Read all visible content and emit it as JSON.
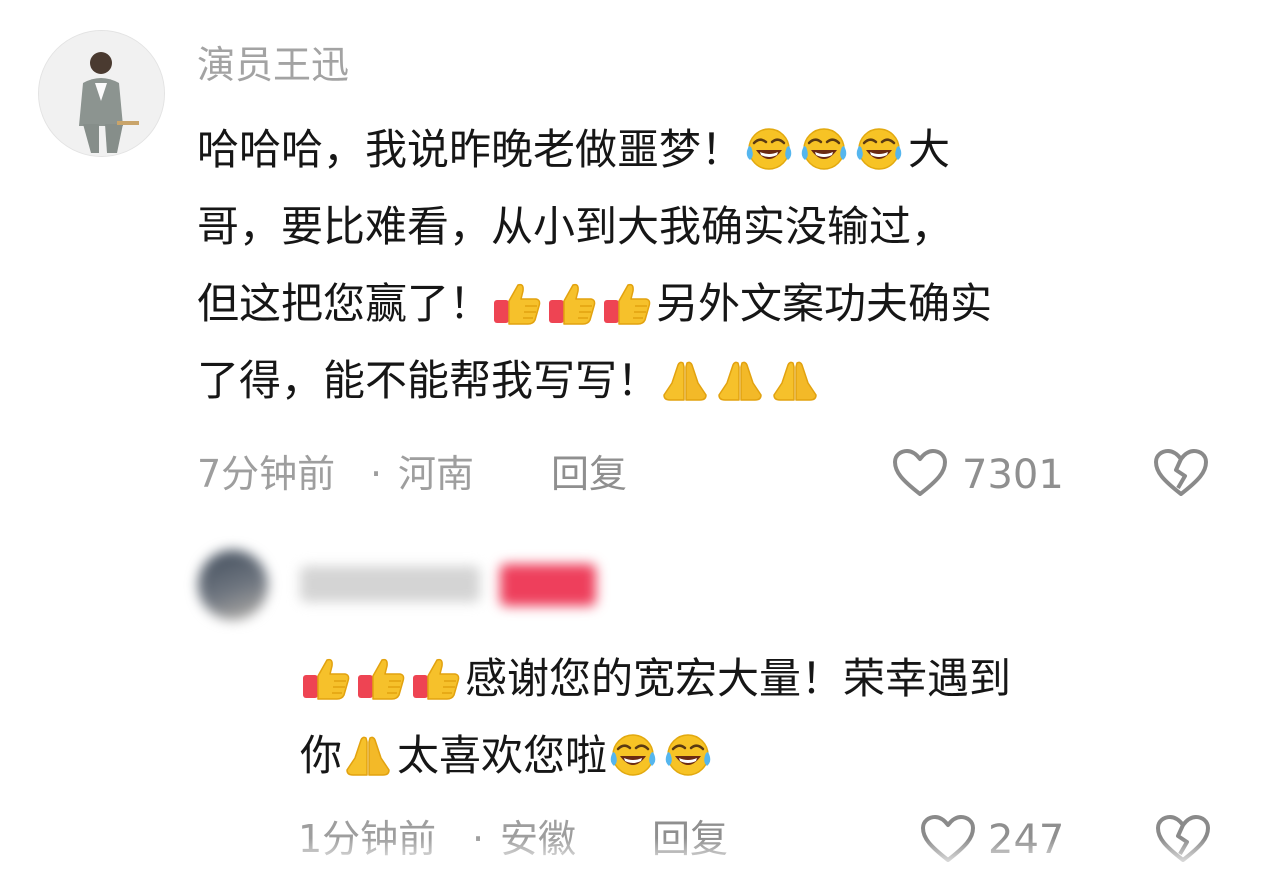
{
  "comments": [
    {
      "username": "演员王迅",
      "lines": [
        {
          "segments": [
            {
              "t": "text",
              "v": "哈哈哈，我说昨晚老做噩梦！"
            },
            {
              "t": "emoji",
              "v": "laugh-cry"
            },
            {
              "t": "emoji",
              "v": "laugh-cry"
            },
            {
              "t": "emoji",
              "v": "laugh-cry"
            },
            {
              "t": "text",
              "v": "大"
            }
          ]
        },
        {
          "segments": [
            {
              "t": "text",
              "v": "哥，要比难看，从小到大我确实没输过，"
            }
          ]
        },
        {
          "segments": [
            {
              "t": "text",
              "v": "但这把您赢了！"
            },
            {
              "t": "emoji",
              "v": "thumbs-up"
            },
            {
              "t": "emoji",
              "v": "thumbs-up"
            },
            {
              "t": "emoji",
              "v": "thumbs-up"
            },
            {
              "t": "text",
              "v": "另外文案功夫确实"
            }
          ]
        },
        {
          "segments": [
            {
              "t": "text",
              "v": "了得，能不能帮我写写！"
            },
            {
              "t": "emoji",
              "v": "pray"
            },
            {
              "t": "emoji",
              "v": "pray"
            },
            {
              "t": "emoji",
              "v": "pray"
            }
          ]
        }
      ],
      "time": "7分钟前",
      "separator": "·",
      "location": "河南",
      "reply_label": "回复",
      "likes": "7301"
    },
    {
      "username": "",
      "badge": "",
      "lines": [
        {
          "segments": [
            {
              "t": "emoji",
              "v": "thumbs-up"
            },
            {
              "t": "emoji",
              "v": "thumbs-up"
            },
            {
              "t": "emoji",
              "v": "thumbs-up"
            },
            {
              "t": "text",
              "v": "感谢您的宽宏大量！荣幸遇到"
            }
          ]
        },
        {
          "segments": [
            {
              "t": "text",
              "v": "你"
            },
            {
              "t": "emoji",
              "v": "pray"
            },
            {
              "t": "text",
              "v": "太喜欢您啦"
            },
            {
              "t": "emoji",
              "v": "laugh-cry"
            },
            {
              "t": "emoji",
              "v": "laugh-cry"
            }
          ]
        }
      ],
      "time": "1分钟前",
      "separator": "·",
      "location": "安徽",
      "reply_label": "回复",
      "likes": "247"
    }
  ],
  "colors": {
    "username": "#a3a3a3",
    "meta": "#9e9e9e",
    "badge": "#ee3f5c"
  }
}
